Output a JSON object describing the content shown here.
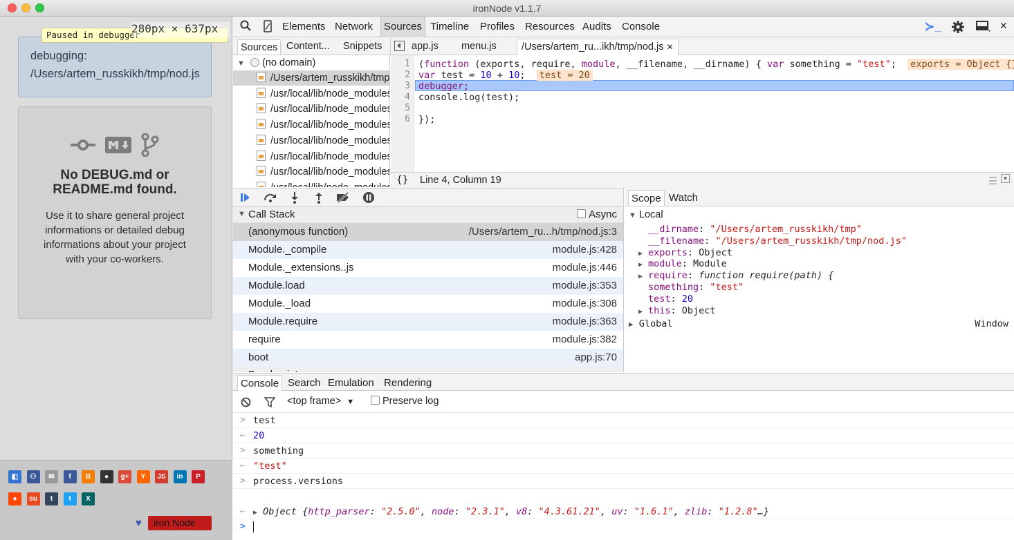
{
  "window": {
    "title": "ironNode v1.1.7"
  },
  "left": {
    "paused_text": "Paused in debugger",
    "size_tip": "280px × 637px",
    "debug_label": "debugging:",
    "debug_path": "/Users/artem_russkikh/tmp/nod.js",
    "empty_title": "No DEBUG.md or README.md found.",
    "empty_text": "Use it to share general project informations or detailed debug informations about your project with your co-workers.",
    "icons": [
      "commit-icon",
      "markdown-icon",
      "branch-icon"
    ],
    "social": [
      {
        "name": "delicious-icon",
        "color": "#3274d1",
        "glyph": "◧"
      },
      {
        "name": "myspace-icon",
        "color": "#3b5998",
        "glyph": "⚇"
      },
      {
        "name": "email-icon",
        "color": "#9a9a9a",
        "glyph": "✉"
      },
      {
        "name": "facebook-icon",
        "color": "#3b5998",
        "glyph": "f"
      },
      {
        "name": "blogger-icon",
        "color": "#f57d00",
        "glyph": "B"
      },
      {
        "name": "github-icon",
        "color": "#333333",
        "glyph": "●"
      },
      {
        "name": "googleplus-icon",
        "color": "#dd4b39",
        "glyph": "g+"
      },
      {
        "name": "hackernews-icon",
        "color": "#ff6600",
        "glyph": "Y"
      },
      {
        "name": "echojs-icon",
        "color": "#d33a2c",
        "glyph": "JS"
      },
      {
        "name": "linkedin-icon",
        "color": "#0077b5",
        "glyph": "in"
      },
      {
        "name": "pinterest-icon",
        "color": "#cb2027",
        "glyph": "P"
      },
      {
        "name": "reddit-icon",
        "color": "#ff4500",
        "glyph": "●"
      },
      {
        "name": "stumbleupon-icon",
        "color": "#eb4924",
        "glyph": "su"
      },
      {
        "name": "tumblr-icon",
        "color": "#35465c",
        "glyph": "t"
      },
      {
        "name": "twitter-icon",
        "color": "#1da1f2",
        "glyph": "t"
      },
      {
        "name": "xing-icon",
        "color": "#026466",
        "glyph": "X"
      }
    ],
    "iron_a": "iron",
    "iron_b": "Node"
  },
  "toolbar": {
    "tabs": [
      "Elements",
      "Network",
      "Sources",
      "Timeline",
      "Profiles",
      "Resources",
      "Audits",
      "Console"
    ],
    "active": "Sources"
  },
  "sources_tabs": [
    "Sources",
    "Content...",
    "Snippets"
  ],
  "navigator": {
    "domain": "(no domain)",
    "files": [
      "/Users/artem_russkikh/tmp/nod.js",
      "/usr/local/lib/node_modules",
      "/usr/local/lib/node_modules",
      "/usr/local/lib/node_modules",
      "/usr/local/lib/node_modules",
      "/usr/local/lib/node_modules",
      "/usr/local/lib/node_modules",
      "/usr/local/lib/node_modules"
    ]
  },
  "editor_tabs": [
    "app.js",
    "menu.js",
    "/Users/artem_ru...ikh/tmp/nod.js"
  ],
  "editor": {
    "line1": {
      "p1": "(",
      "kw1": "function",
      "p2": " (exports, require, ",
      "kw2": "module",
      "p3": ", __filename, __dirname) { ",
      "kw3": "var",
      "p4": " something = ",
      "s1": "\"test\"",
      "p5": ";",
      "inline": "exports = Object {}, re"
    },
    "line2": {
      "kw": "var",
      "p1": " test = ",
      "n1": "10",
      "p2": " + ",
      "n2": "10",
      "p3": ";",
      "inline": "test = 20"
    },
    "line3": "debugger;",
    "line4": "console.log(test);",
    "line5": "",
    "line6": "});",
    "line_numbers": [
      "1",
      "2",
      "3",
      "4",
      "5",
      "6"
    ],
    "status": "Line 4, Column 19",
    "braces": "{}"
  },
  "callstack": {
    "title": "Call Stack",
    "async": "Async",
    "rows": [
      {
        "fn": "(anonymous function)",
        "loc": "/Users/artem_ru...h/tmp/nod.js:3"
      },
      {
        "fn": "Module._compile",
        "loc": "module.js:428"
      },
      {
        "fn": "Module._extensions..js",
        "loc": "module.js:446"
      },
      {
        "fn": "Module.load",
        "loc": "module.js:353"
      },
      {
        "fn": "Module._load",
        "loc": "module.js:308"
      },
      {
        "fn": "Module.require",
        "loc": "module.js:363"
      },
      {
        "fn": "require",
        "loc": "module.js:382"
      },
      {
        "fn": "boot",
        "loc": "app.js:70"
      }
    ],
    "next_section": "Breakpoints"
  },
  "scope": {
    "tabs": [
      "Scope",
      "Watch"
    ],
    "local": "Local",
    "global": "Global",
    "global_value": "Window",
    "vars": [
      {
        "k": "__dirname",
        "v": "\"/Users/artem_russkikh/tmp\"",
        "kind": "str",
        "exp": false
      },
      {
        "k": "__filename",
        "v": "\"/Users/artem_russkikh/tmp/nod.js\"",
        "kind": "str",
        "exp": false
      },
      {
        "k": "exports",
        "v": "Object",
        "kind": "obj",
        "exp": true
      },
      {
        "k": "module",
        "v": "Module",
        "kind": "obj",
        "exp": true
      },
      {
        "k": "require",
        "v": "function require(path) {",
        "kind": "fn",
        "exp": true
      },
      {
        "k": "something",
        "v": "\"test\"",
        "kind": "str",
        "exp": false
      },
      {
        "k": "test",
        "v": "20",
        "kind": "num",
        "exp": false
      },
      {
        "k": "this",
        "v": "Object",
        "kind": "obj",
        "exp": true
      }
    ]
  },
  "console": {
    "tabs": [
      "Console",
      "Search",
      "Emulation",
      "Rendering"
    ],
    "frame": "<top frame>",
    "preserve": "Preserve log",
    "lines": [
      {
        "dir": "in",
        "text": "test"
      },
      {
        "dir": "out",
        "text": "20",
        "kind": "num"
      },
      {
        "dir": "in",
        "text": "something"
      },
      {
        "dir": "out",
        "text": "\"test\"",
        "kind": "str"
      },
      {
        "dir": "in",
        "text": "process.versions"
      }
    ],
    "object_line": {
      "label": "Object {",
      "k1": "http_parser",
      "v1": "\"2.5.0\"",
      "k2": "node",
      "v2": "\"2.3.1\"",
      "k3": "v8",
      "v3": "\"4.3.61.21\"",
      "k4": "uv",
      "v4": "\"1.6.1\"",
      "k5": "zlib",
      "v5": "\"1.2.8\"",
      "end": "…}"
    }
  },
  "colors": {
    "accent": "#3b7cef",
    "highlight": "#a8c7fa",
    "selected_row": "#d4d4d4"
  }
}
